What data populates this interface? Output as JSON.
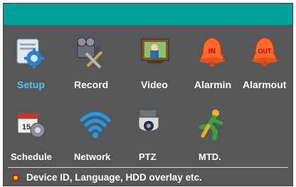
{
  "menu": {
    "row1": [
      {
        "label": "Setup",
        "icon": "setup-icon"
      },
      {
        "label": "Record",
        "icon": "record-icon"
      },
      {
        "label": "Video",
        "icon": "video-icon"
      },
      {
        "label": "Alarmin",
        "icon": "alarmin-icon"
      },
      {
        "label": "Alarmout",
        "icon": "alarmout-icon"
      }
    ],
    "row2": [
      {
        "label": "Schedule",
        "icon": "schedule-icon"
      },
      {
        "label": "Network",
        "icon": "network-icon"
      },
      {
        "label": "PTZ",
        "icon": "ptz-icon"
      },
      {
        "label": "MTD.",
        "icon": "motion-detect-icon"
      }
    ],
    "selected": "Setup",
    "alarm_badges": {
      "in": "IN",
      "out": "OUT"
    },
    "calendar_day": "15"
  },
  "status": {
    "text": "Device ID, Language, HDD  overlay etc."
  },
  "colors": {
    "titlebar": "#00a19c",
    "panel": "#555758",
    "selected_label": "#4fc3ff",
    "text": "#ffffff"
  }
}
